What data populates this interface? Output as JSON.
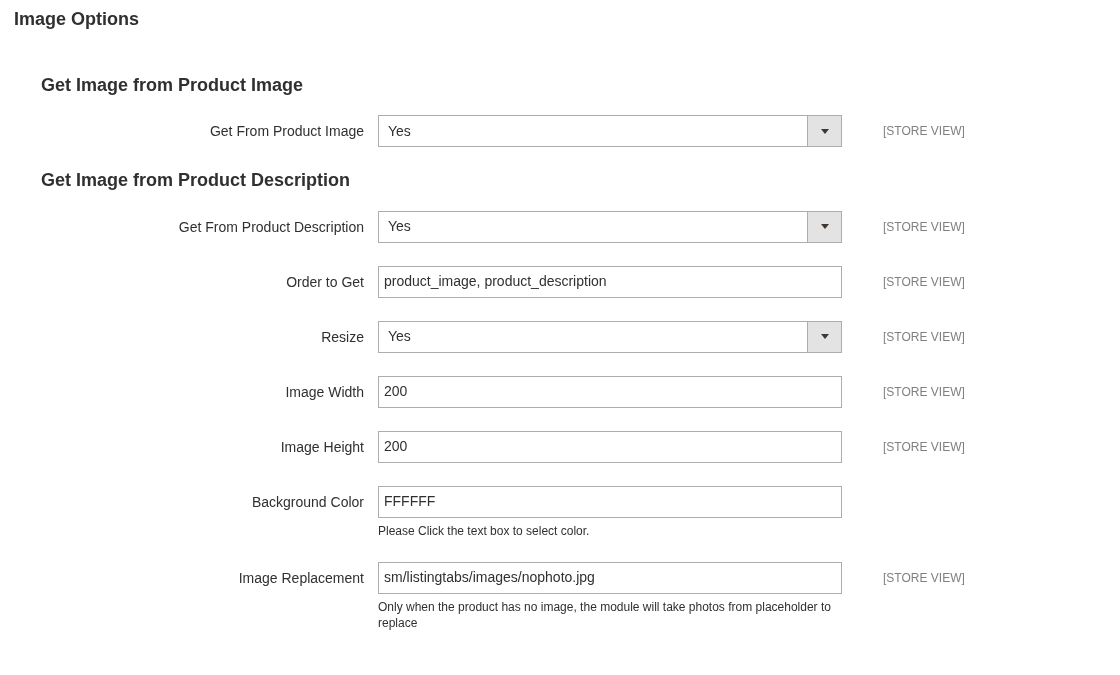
{
  "title": "Image Options",
  "sections": [
    {
      "heading": "Get Image from Product Image",
      "fields": [
        {
          "kind": "select",
          "label": "Get From Product Image",
          "value": "Yes",
          "scope": "[STORE VIEW]"
        }
      ]
    },
    {
      "heading": "Get Image from Product Description",
      "fields": [
        {
          "kind": "select",
          "label": "Get From Product Description",
          "value": "Yes",
          "scope": "[STORE VIEW]"
        },
        {
          "kind": "text",
          "label": "Order to Get",
          "value": "product_image, product_description",
          "scope": "[STORE VIEW]"
        },
        {
          "kind": "select",
          "label": "Resize",
          "value": "Yes",
          "scope": "[STORE VIEW]"
        },
        {
          "kind": "text",
          "label": "Image Width",
          "value": "200",
          "scope": "[STORE VIEW]"
        },
        {
          "kind": "text",
          "label": "Image Height",
          "value": "200",
          "scope": "[STORE VIEW]"
        },
        {
          "kind": "text",
          "label": "Background Color",
          "value": "FFFFFF",
          "note": "Please Click the text box to select color."
        },
        {
          "kind": "text",
          "label": "Image Replacement",
          "value": "sm/listingtabs/images/nophoto.jpg",
          "scope": "[STORE VIEW]",
          "note": "Only when the product has no image, the module will take photos from placeholder to replace"
        }
      ]
    }
  ]
}
